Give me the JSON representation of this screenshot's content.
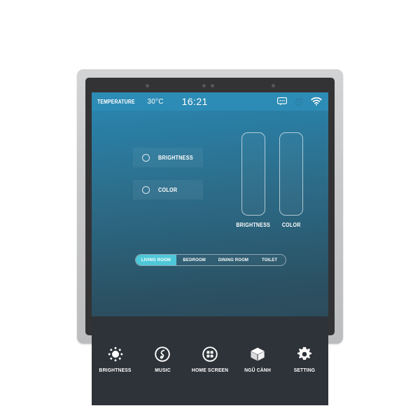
{
  "device": {
    "name": "wall-mounted smart home touch panel",
    "frame_color": "#c8c9cb",
    "bezel_color": "#333335",
    "sensor_dot_color": "#55565a",
    "sensor_dots": 4
  },
  "screen": {
    "gradient_top": "#2b89b4",
    "gradient_bottom": "#2c4c5c"
  },
  "status_bar": {
    "background": "#2d8cb5",
    "temperature_label": "TEMPERATURE",
    "temperature_value": "30°C",
    "time": "16:21",
    "icons": [
      {
        "name": "message-icon",
        "glyph": "speech-bubble-dots"
      },
      {
        "name": "alarm-clock-icon",
        "glyph": "clock"
      },
      {
        "name": "wifi-icon",
        "glyph": "wifi-signal"
      }
    ]
  },
  "options": [
    {
      "id": "brightness",
      "label": "BRIGHTNESS",
      "selected": false
    },
    {
      "id": "color",
      "label": "COLOR",
      "selected": false
    }
  ],
  "sliders": [
    {
      "id": "brightness-slider",
      "label": "BRIGHTNESS",
      "value": 0,
      "min": 0,
      "max": 100,
      "orientation": "vertical"
    },
    {
      "id": "color-slider",
      "label": "COLOR",
      "value": 0,
      "min": 0,
      "max": 100,
      "orientation": "vertical"
    }
  ],
  "room_tabs": {
    "active_color": "#4ec8d8",
    "active_index": 0,
    "items": [
      {
        "label": "LIVING ROOM",
        "active": true
      },
      {
        "label": "BEDROOM",
        "active": false
      },
      {
        "label": "DINING ROOM",
        "active": false
      },
      {
        "label": "TOILET",
        "active": false
      }
    ]
  },
  "bottom_nav": {
    "background": "#2e3339",
    "items": [
      {
        "label": "BRIGHTNESS",
        "icon": "sun-icon"
      },
      {
        "label": "MUSIC",
        "icon": "music-note-circle-icon"
      },
      {
        "label": "HOME SCREEN",
        "icon": "grid-circle-icon"
      },
      {
        "label": "NGŨ CẢNH",
        "icon": "cube-icon"
      },
      {
        "label": "SETTING",
        "icon": "gear-icon"
      }
    ]
  }
}
